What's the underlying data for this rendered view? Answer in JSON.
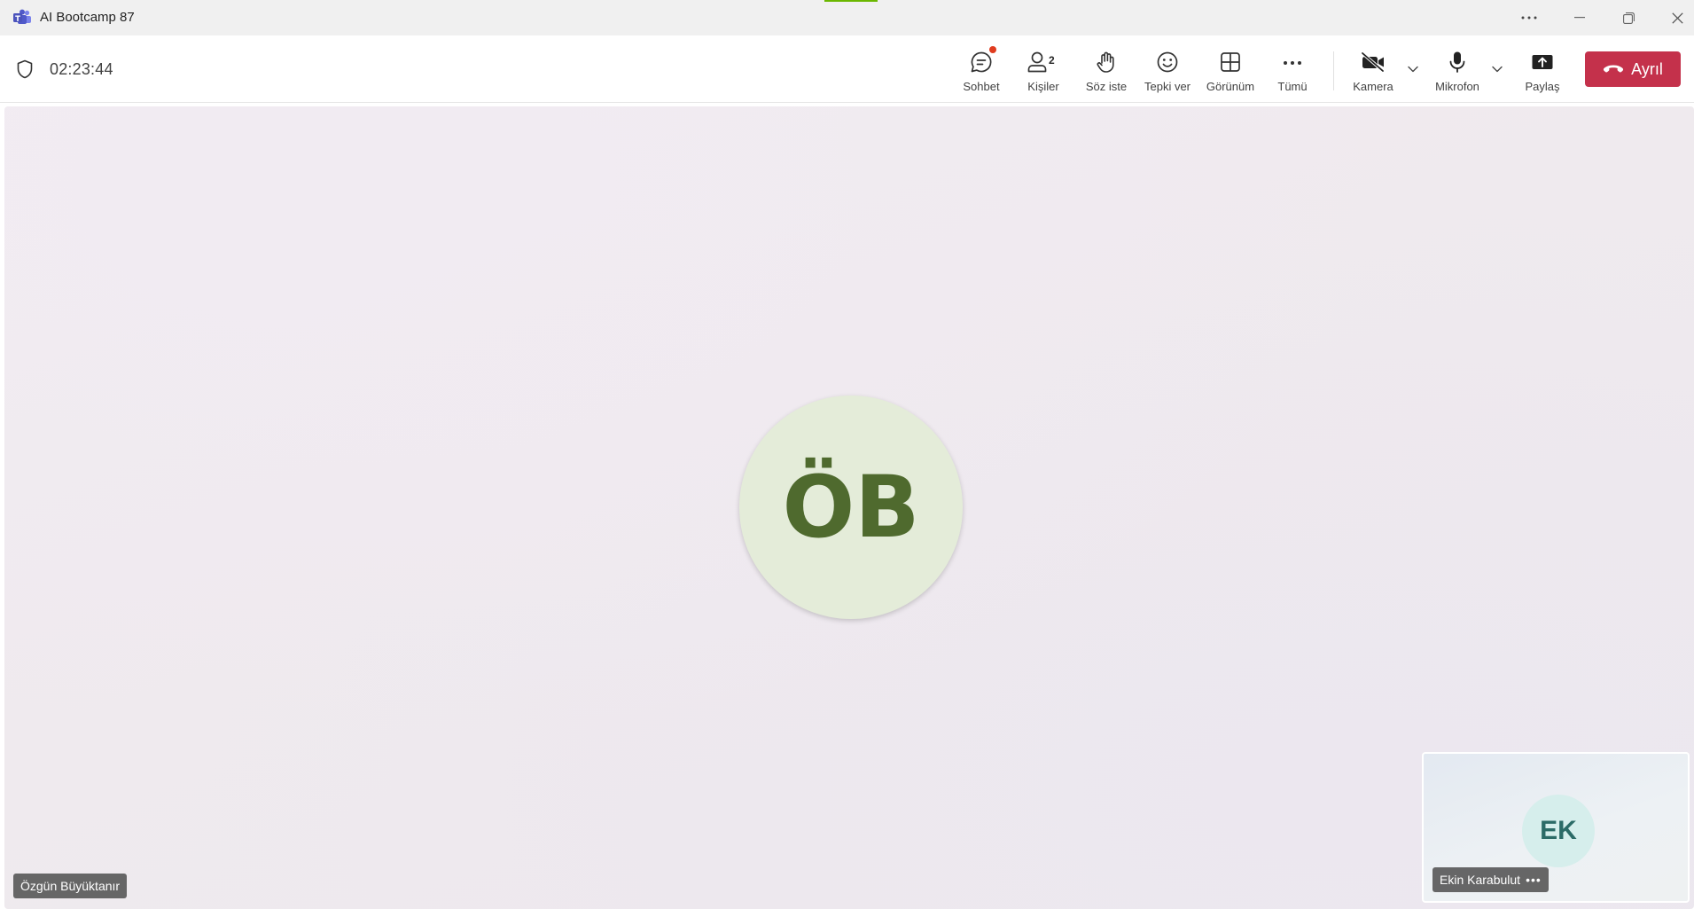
{
  "window": {
    "title": "AI Bootcamp 87"
  },
  "toolbar": {
    "timer": "02:23:44",
    "people_count": "2",
    "buttons": {
      "chat": "Sohbet",
      "people": "Kişiler",
      "raise_hand": "Söz iste",
      "react": "Tepki ver",
      "view": "Görünüm",
      "more": "Tümü",
      "camera": "Kamera",
      "mic": "Mikrofon",
      "share": "Paylaş"
    },
    "leave_label": "Ayrıl",
    "colors": {
      "leave": "#c4314b",
      "notification_dot": "#e03c1f"
    }
  },
  "stage": {
    "main_participant": {
      "initials": "ÖB",
      "name": "Özgün Büyüktanır",
      "avatar_color": "#e4ecd9",
      "initials_color": "#4f6a2e"
    },
    "self_view": {
      "initials": "EK",
      "name": "Ekin Karabulut",
      "more": "•••",
      "avatar_color": "#d6eeec",
      "initials_color": "#2c6b67"
    }
  }
}
